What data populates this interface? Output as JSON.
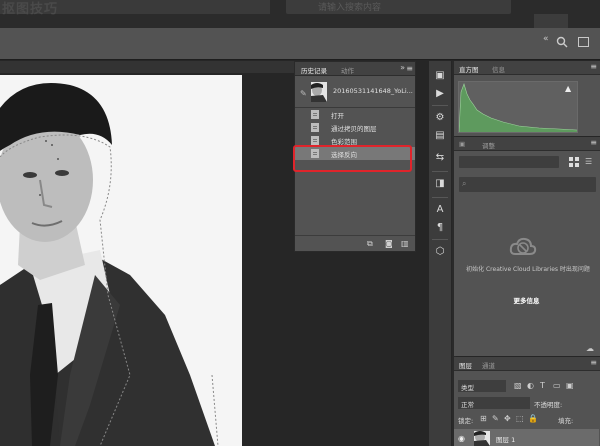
{
  "top_banner": {
    "text": "…",
    "search_placeholder": "请输入搜索内容"
  },
  "history_panel": {
    "tab_active": "历史记录",
    "tab_inactive": "动作",
    "snapshot_name": "20160531141648_YoLi...",
    "steps": [
      "打开",
      "通过拷贝的图层",
      "色彩范围",
      "选择反向"
    ],
    "selected_index": 3
  },
  "histogram_panel": {
    "tab_active": "直方图",
    "tab_inactive": "信息"
  },
  "libraries_panel": {
    "tab_inactive": "调整",
    "message": "初始化 Creative Cloud Libraries 时出现问题",
    "more_link": "更多信息"
  },
  "layers_panel": {
    "tab_active": "图层",
    "tab_inactive": "通道",
    "kind_label": "类型",
    "blend_mode": "正常",
    "opacity_label": "不透明度:",
    "lock_label": "锁定:",
    "fill_label": "填充:",
    "layer_name": "图层 1"
  },
  "colors": {
    "highlight": "#e0242b",
    "histogram_fill": "#5e9a5e"
  }
}
